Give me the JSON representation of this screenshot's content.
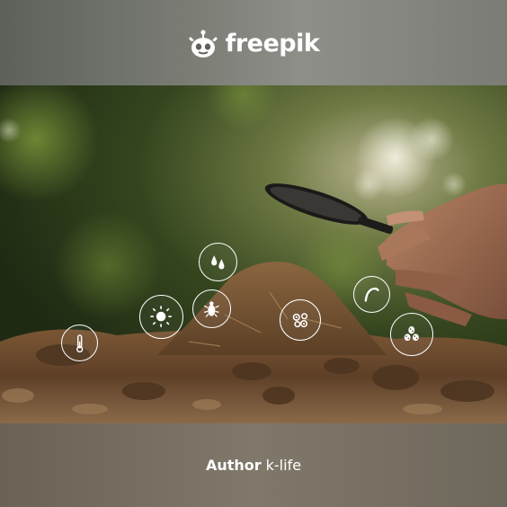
{
  "brand": {
    "name": "freepik",
    "logo_icon": "freepik-robot-logo"
  },
  "credit": {
    "label": "Author",
    "author": "k-life"
  },
  "photo": {
    "icons": [
      {
        "name": "thermometer-icon"
      },
      {
        "name": "sun-icon"
      },
      {
        "name": "water-drops-icon"
      },
      {
        "name": "bug-icon"
      },
      {
        "name": "microbes-icon"
      },
      {
        "name": "worm-icon"
      },
      {
        "name": "bacteria-icon"
      }
    ]
  },
  "colors": {
    "banner_text": "#ffffff",
    "soil": "#6b4a2c",
    "foliage": "#3f5a25"
  }
}
